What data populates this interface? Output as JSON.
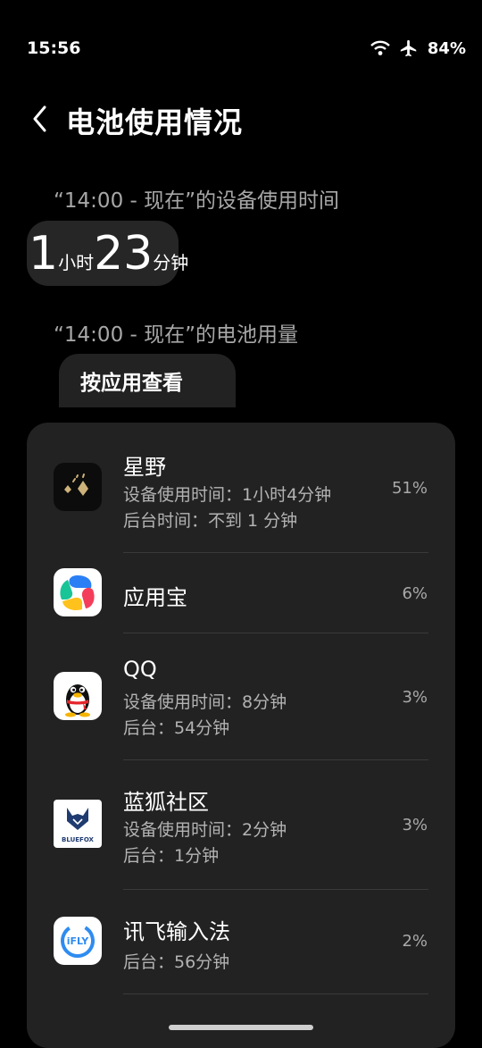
{
  "status_bar": {
    "time": "15:56",
    "battery": "84%",
    "icons": [
      "wifi-icon",
      "airplane-icon"
    ]
  },
  "header": {
    "title": "电池使用情况",
    "back_icon": "chevron-left-icon"
  },
  "usage": {
    "label": "“14:00 - 现在”的设备使用时间",
    "hours": "1",
    "hours_unit": "小时",
    "minutes": "23",
    "minutes_unit": "分钟"
  },
  "battery_usage": {
    "label": "“14:00 - 现在”的电池用量",
    "tab_label": "按应用查看"
  },
  "apps": [
    {
      "name": "星野",
      "line1": "设备使用时间：1小时4分钟",
      "line2": "后台时间：不到 1 分钟",
      "percent": "51%",
      "icon": "xingye-app-icon"
    },
    {
      "name": "应用宝",
      "line1": "",
      "line2": "",
      "percent": "6%",
      "icon": "yingyongbao-app-icon"
    },
    {
      "name": "QQ",
      "line1": "设备使用时间：8分钟",
      "line2": "后台：54分钟",
      "percent": "3%",
      "icon": "qq-penguin-icon"
    },
    {
      "name": "蓝狐社区",
      "line1": "设备使用时间：2分钟",
      "line2": "后台：1分钟",
      "percent": "3%",
      "icon": "bluefox-app-icon",
      "icon_text": "BLUEFOX"
    },
    {
      "name": "讯飞输入法",
      "line1": "后台：56分钟",
      "line2": "",
      "percent": "2%",
      "icon": "ifly-app-icon",
      "icon_text": "iFLY"
    }
  ],
  "colors": {
    "background": "#000000",
    "card": "#222222",
    "secondary_text": "#a7a7a7"
  }
}
